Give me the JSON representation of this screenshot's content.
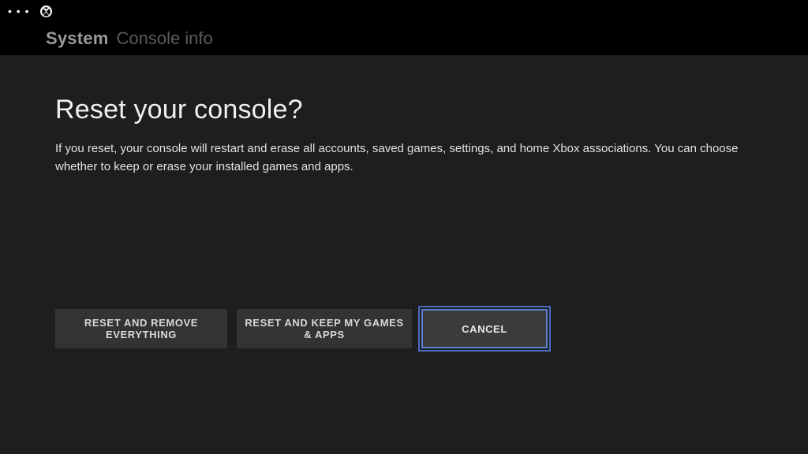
{
  "topbar": {
    "ellipsis": "• • •"
  },
  "header": {
    "system_label": "System",
    "breadcrumb": "Console info"
  },
  "main": {
    "title": "Reset your console?",
    "description": "If you reset, your console will restart and erase all accounts, saved games, settings, and home Xbox associations. You can choose whether to keep or erase your installed games and apps."
  },
  "buttons": {
    "reset_remove": "RESET AND REMOVE EVERYTHING",
    "reset_keep": "RESET AND KEEP MY GAMES & APPS",
    "cancel": "CANCEL"
  }
}
